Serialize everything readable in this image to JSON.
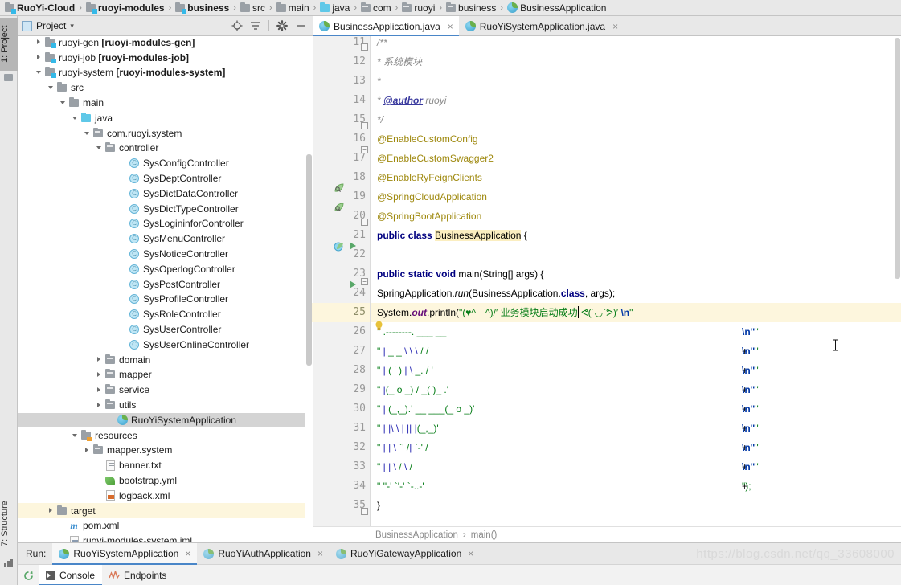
{
  "window": {
    "breadcrumb": [
      {
        "label": "RuoYi-Cloud",
        "icon": "module-icon",
        "bold": true
      },
      {
        "label": "ruoyi-modules",
        "icon": "module-icon",
        "bold": true
      },
      {
        "label": "business",
        "icon": "module-icon",
        "bold": true
      },
      {
        "label": "src",
        "icon": "folder-icon",
        "bold": false
      },
      {
        "label": "main",
        "icon": "folder-icon",
        "bold": false
      },
      {
        "label": "java",
        "icon": "source-folder-icon",
        "bold": false
      },
      {
        "label": "com",
        "icon": "package-icon",
        "bold": false
      },
      {
        "label": "ruoyi",
        "icon": "package-icon",
        "bold": false
      },
      {
        "label": "business",
        "icon": "package-icon",
        "bold": false
      },
      {
        "label": "BusinessApplication",
        "icon": "spring-class-icon",
        "bold": false
      }
    ],
    "separator": "›"
  },
  "left_strip": {
    "tabs": [
      {
        "label": "1: Project",
        "selected": true
      },
      {
        "label": "7: Structure",
        "selected": false
      }
    ]
  },
  "project_panel": {
    "title": "Project",
    "chevron": "▾",
    "tools": [
      {
        "name": "locate-icon",
        "glyph": "⊕"
      },
      {
        "name": "collapse-all-icon",
        "glyph": "≡"
      },
      {
        "name": "settings-gear-icon",
        "glyph": "⚙"
      },
      {
        "name": "hide-icon",
        "glyph": "−"
      }
    ],
    "tree": [
      {
        "indent": 1,
        "arrow": "right",
        "icon": "module-icon",
        "text": "ruoyi-gen ",
        "bold": "[ruoyi-modules-gen]",
        "state": "normal"
      },
      {
        "indent": 1,
        "arrow": "right",
        "icon": "module-icon",
        "text": "ruoyi-job ",
        "bold": "[ruoyi-modules-job]",
        "state": "normal"
      },
      {
        "indent": 1,
        "arrow": "down",
        "icon": "module-icon",
        "text": "ruoyi-system ",
        "bold": "[ruoyi-modules-system]",
        "state": "normal"
      },
      {
        "indent": 2,
        "arrow": "down",
        "icon": "folder-icon",
        "text": "src",
        "bold": "",
        "state": "normal"
      },
      {
        "indent": 3,
        "arrow": "down",
        "icon": "folder-icon",
        "text": "main",
        "bold": "",
        "state": "normal"
      },
      {
        "indent": 4,
        "arrow": "down",
        "icon": "source-folder-icon",
        "text": "java",
        "bold": "",
        "state": "normal"
      },
      {
        "indent": 5,
        "arrow": "down",
        "icon": "package-icon",
        "text": "com.ruoyi.system",
        "bold": "",
        "state": "normal"
      },
      {
        "indent": 6,
        "arrow": "down",
        "icon": "package-icon",
        "text": "controller",
        "bold": "",
        "state": "normal"
      },
      {
        "indent": 8,
        "arrow": "none",
        "icon": "class-icon",
        "text": "SysConfigController",
        "bold": "",
        "state": "normal"
      },
      {
        "indent": 8,
        "arrow": "none",
        "icon": "class-icon",
        "text": "SysDeptController",
        "bold": "",
        "state": "normal"
      },
      {
        "indent": 8,
        "arrow": "none",
        "icon": "class-icon",
        "text": "SysDictDataController",
        "bold": "",
        "state": "normal"
      },
      {
        "indent": 8,
        "arrow": "none",
        "icon": "class-icon",
        "text": "SysDictTypeController",
        "bold": "",
        "state": "normal"
      },
      {
        "indent": 8,
        "arrow": "none",
        "icon": "class-icon",
        "text": "SysLogininforController",
        "bold": "",
        "state": "normal"
      },
      {
        "indent": 8,
        "arrow": "none",
        "icon": "class-icon",
        "text": "SysMenuController",
        "bold": "",
        "state": "normal"
      },
      {
        "indent": 8,
        "arrow": "none",
        "icon": "class-icon",
        "text": "SysNoticeController",
        "bold": "",
        "state": "normal"
      },
      {
        "indent": 8,
        "arrow": "none",
        "icon": "class-icon",
        "text": "SysOperlogController",
        "bold": "",
        "state": "normal"
      },
      {
        "indent": 8,
        "arrow": "none",
        "icon": "class-icon",
        "text": "SysPostController",
        "bold": "",
        "state": "normal"
      },
      {
        "indent": 8,
        "arrow": "none",
        "icon": "class-icon",
        "text": "SysProfileController",
        "bold": "",
        "state": "normal"
      },
      {
        "indent": 8,
        "arrow": "none",
        "icon": "class-icon",
        "text": "SysRoleController",
        "bold": "",
        "state": "normal"
      },
      {
        "indent": 8,
        "arrow": "none",
        "icon": "class-icon",
        "text": "SysUserController",
        "bold": "",
        "state": "normal"
      },
      {
        "indent": 8,
        "arrow": "none",
        "icon": "class-icon",
        "text": "SysUserOnlineController",
        "bold": "",
        "state": "normal"
      },
      {
        "indent": 6,
        "arrow": "right",
        "icon": "package-icon",
        "text": "domain",
        "bold": "",
        "state": "normal"
      },
      {
        "indent": 6,
        "arrow": "right",
        "icon": "package-icon",
        "text": "mapper",
        "bold": "",
        "state": "normal"
      },
      {
        "indent": 6,
        "arrow": "right",
        "icon": "package-icon",
        "text": "service",
        "bold": "",
        "state": "normal"
      },
      {
        "indent": 6,
        "arrow": "right",
        "icon": "package-icon",
        "text": "utils",
        "bold": "",
        "state": "normal"
      },
      {
        "indent": 7,
        "arrow": "none",
        "icon": "spring-class-icon",
        "text": "RuoYiSystemApplication",
        "bold": "",
        "state": "selected"
      },
      {
        "indent": 4,
        "arrow": "down",
        "icon": "resources-folder-icon",
        "text": "resources",
        "bold": "",
        "state": "normal"
      },
      {
        "indent": 5,
        "arrow": "right",
        "icon": "package-icon",
        "text": "mapper.system",
        "bold": "",
        "state": "normal"
      },
      {
        "indent": 6,
        "arrow": "none",
        "icon": "text-file-icon",
        "text": "banner.txt",
        "bold": "",
        "state": "normal"
      },
      {
        "indent": 6,
        "arrow": "none",
        "icon": "yaml-file-icon",
        "text": "bootstrap.yml",
        "bold": "",
        "state": "normal"
      },
      {
        "indent": 6,
        "arrow": "none",
        "icon": "xml-file-icon",
        "text": "logback.xml",
        "bold": "",
        "state": "normal"
      },
      {
        "indent": 2,
        "arrow": "right",
        "icon": "folder-icon",
        "text": "target",
        "bold": "",
        "state": "highlighted"
      },
      {
        "indent": 3,
        "arrow": "none",
        "icon": "maven-pom-icon",
        "text": "pom.xml",
        "bold": "",
        "state": "normal"
      },
      {
        "indent": 3,
        "arrow": "none",
        "icon": "iml-file-icon",
        "text": "ruoyi-modules-system.iml",
        "bold": "",
        "state": "normal"
      }
    ]
  },
  "editor": {
    "tabs": [
      {
        "label": "BusinessApplication.java",
        "icon": "spring-class-icon",
        "active": true,
        "close": "×"
      },
      {
        "label": "RuoYiSystemApplication.java",
        "icon": "spring-class-icon",
        "active": false,
        "close": "×"
      }
    ],
    "first_line_number": 11,
    "current_line": 25,
    "line_numbers": [
      11,
      12,
      13,
      14,
      15,
      16,
      17,
      18,
      19,
      20,
      21,
      22,
      23,
      24,
      25,
      26,
      27,
      28,
      29,
      30,
      31,
      32,
      33,
      34,
      35
    ],
    "breadcrumb": [
      "BusinessApplication",
      "main()"
    ],
    "breadcrumb_separator": "›",
    "code_lines": [
      {
        "n": 11,
        "text": "/**"
      },
      {
        "n": 12,
        "text": " * 系统模块"
      },
      {
        "n": 13,
        "text": " *"
      },
      {
        "n": 14,
        "text": " * @author ruoyi"
      },
      {
        "n": 15,
        "text": " */"
      },
      {
        "n": 16,
        "text": "@EnableCustomConfig"
      },
      {
        "n": 17,
        "text": "@EnableCustomSwagger2"
      },
      {
        "n": 18,
        "text": "@EnableRyFeignClients"
      },
      {
        "n": 19,
        "text": "@SpringCloudApplication"
      },
      {
        "n": 20,
        "text": "@SpringBootApplication"
      },
      {
        "n": 21,
        "text": "public class BusinessApplication {"
      },
      {
        "n": 22,
        "text": ""
      },
      {
        "n": 23,
        "text": "    public static void main(String[] args) {"
      },
      {
        "n": 24,
        "text": "        SpringApplication.run(BusinessApplication.class, args);"
      },
      {
        "n": 25,
        "text": "        System.out.println(\"(♥^＿^)/′  业务模块启动成功   ᕙ(´◡`ᕗ)′  \\n\""
      },
      {
        "n": 26,
        "text": "                + \" .--------.                ___        __          \\n\" +"
      },
      {
        "n": 27,
        "text": "                + \" |  _ _   \\\\\\\\      \\\\\\\\   \\\\\\\\   /  /        \\n\" +"
      },
      {
        "n": 28,
        "text": "                + \" | ( ' )  |        \\\\\\\\  _. /  '        \\n\" +"
      },
      {
        "n": 29,
        "text": "                + \" |(_ o _) /         _( )_ .'         \\n\" +"
      },
      {
        "n": 30,
        "text": "                + \" | (_,_).' __  ___(_ o _)'        \\n\" +"
      },
      {
        "n": 31,
        "text": "                + \" |  |\\\\ \\\\  |  ||  |(_,_)'         \\n\" +"
      },
      {
        "n": 32,
        "text": "                + \" |  | \\\\ `'   /|   `-'  /          \\n\" +"
      },
      {
        "n": 33,
        "text": "                + \" |  |  \\\\    /  \\\\      /           \\n\" +"
      },
      {
        "n": 34,
        "text": "                + \" ''-'     `'-'    `-..-'           \");"
      },
      {
        "n": 35,
        "text": "    }"
      }
    ],
    "ascii_art": [
      {
        "prefix": "\"",
        "body": " .--------.                ___        __",
        "suffix": "\\n\"",
        "plus": "+"
      },
      {
        "prefix": "\"",
        "body": " |  _ _   \\\\       \\\\   \\\\   /  /",
        "suffix": "\\n\"",
        "plus": "+"
      },
      {
        "prefix": "\"",
        "body": " | ( ' )  |         \\\\  _. /  '",
        "suffix": "\\n\"",
        "plus": "+"
      },
      {
        "prefix": "\"",
        "body": " |(_ o _) /           _( )_ .'",
        "suffix": "\\n\"",
        "plus": "+"
      },
      {
        "prefix": "\"",
        "body": " | (_,_).' __  ___(_ o _)'",
        "suffix": "\\n\"",
        "plus": "+"
      },
      {
        "prefix": "\"",
        "body": " |  |\\\\ \\\\   |  ||   |(_,_)'",
        "suffix": "\\n\"",
        "plus": "+"
      },
      {
        "prefix": "\"",
        "body": " |  | \\\\ `'   /|   `-'  /",
        "suffix": "\\n\"",
        "plus": "+"
      },
      {
        "prefix": "\"",
        "body": " |  |  \\\\    /  \\\\      /",
        "suffix": "\\n\"",
        "plus": "+"
      },
      {
        "prefix": "\"",
        "body": " ''-'    `'-'    `-..-'",
        "suffix": "\");",
        "plus": ""
      }
    ],
    "println_parts": {
      "sys": "System.",
      "out": "out",
      "dot": ".",
      "println": "println(",
      "quote": "\"",
      "face1": "(♥^＿^)/′",
      "cn": "业务模块启动成功",
      "face2": "ᕙ(´◡`ᕗ)′",
      "nl": "\\n",
      "endquote": "\""
    }
  },
  "run_panel": {
    "label": "Run:",
    "tabs": [
      {
        "label": "RuoYiSystemApplication",
        "active": true,
        "close": "×"
      },
      {
        "label": "RuoYiAuthApplication",
        "active": false,
        "close": "×"
      },
      {
        "label": "RuoYiGatewayApplication",
        "active": false,
        "close": "×"
      }
    ],
    "sub_tabs": [
      {
        "label": "Console",
        "icon": "console-icon",
        "active": true
      },
      {
        "label": "Endpoints",
        "icon": "endpoints-icon",
        "active": false
      }
    ],
    "rerun_icon": "rerun-icon"
  },
  "watermark": "https://blog.csdn.net/qq_33608000",
  "colors": {
    "accent": "#4a86c8",
    "keyword": "#000080",
    "annotation": "#9e880d",
    "string": "#067d17",
    "escape": "#0037a6",
    "comment": "#8a8a8a",
    "field": "#660e7a",
    "selection": "#d4d4d4",
    "current_line": "#fdf6dd",
    "panel_bg": "#e8e8e8"
  }
}
